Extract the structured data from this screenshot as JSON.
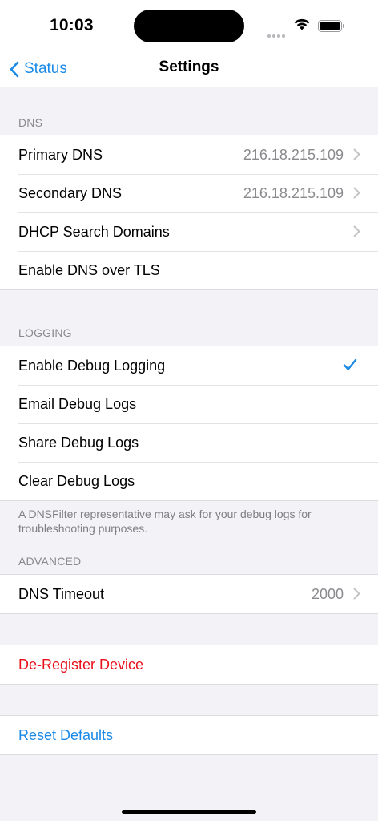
{
  "status_bar": {
    "time": "10:03"
  },
  "nav": {
    "back_label": "Status",
    "title": "Settings"
  },
  "dns": {
    "header": "DNS",
    "rows": [
      {
        "label": "Primary DNS",
        "value": "216.18.215.109"
      },
      {
        "label": "Secondary DNS",
        "value": "216.18.215.109"
      },
      {
        "label": "DHCP Search Domains",
        "value": ""
      },
      {
        "label": "Enable DNS over TLS",
        "value": ""
      }
    ]
  },
  "logging": {
    "header": "LOGGING",
    "rows": [
      {
        "label": "Enable Debug Logging",
        "checked": true
      },
      {
        "label": "Email Debug Logs"
      },
      {
        "label": "Share Debug Logs"
      },
      {
        "label": "Clear Debug Logs"
      }
    ],
    "footer": "A DNSFilter representative may ask for your debug logs for troubleshooting purposes."
  },
  "advanced": {
    "header": "ADVANCED",
    "rows": [
      {
        "label": "DNS Timeout",
        "value": "2000"
      }
    ]
  },
  "actions": {
    "deregister": "De-Register Device",
    "reset": "Reset Defaults"
  },
  "colors": {
    "accent": "#1a8ae6",
    "destructive": "#e8101a",
    "background": "#f2f2f7"
  }
}
